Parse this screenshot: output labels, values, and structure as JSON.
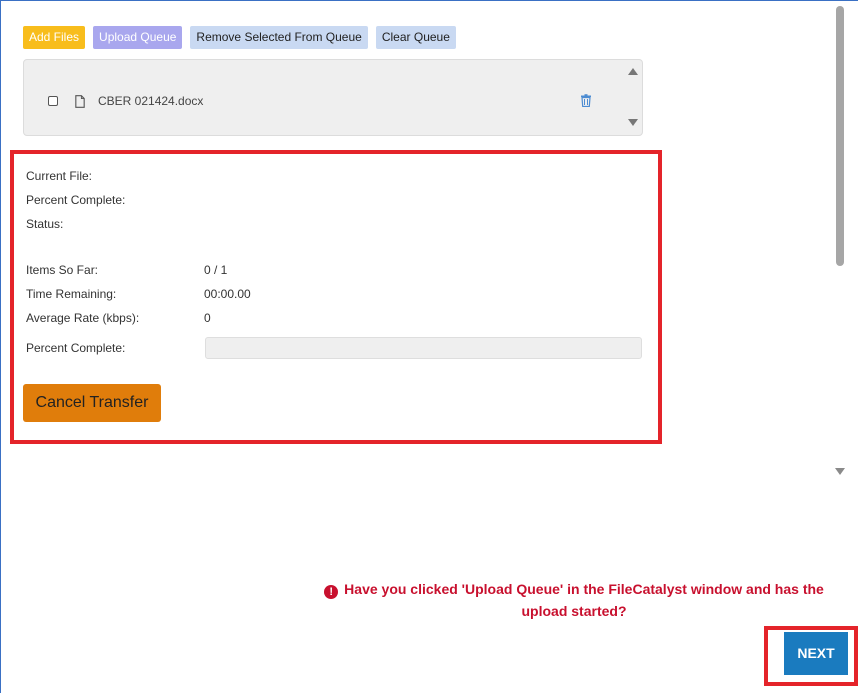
{
  "toolbar": {
    "add_files": "Add Files",
    "upload_queue": "Upload Queue",
    "remove_selected": "Remove Selected From Queue",
    "clear_queue": "Clear Queue"
  },
  "queue": {
    "files": [
      {
        "name": "CBER 021424.docx",
        "checked": false
      }
    ]
  },
  "status": {
    "current_file_label": "Current File:",
    "current_file_value": "",
    "percent_complete_label": "Percent Complete:",
    "percent_complete_value": "",
    "status_label": "Status:",
    "status_value": "",
    "items_so_far_label": "Items So Far:",
    "items_so_far_value": "0 / 1",
    "time_remaining_label": "Time Remaining:",
    "time_remaining_value": "00:00.00",
    "average_rate_label": "Average Rate (kbps):",
    "average_rate_value": "0",
    "progress_label": "Percent Complete:",
    "progress_fraction": 0,
    "cancel_label": "Cancel Transfer"
  },
  "prompt": {
    "icon": "exclamation-circle-icon",
    "text": "Have you clicked 'Upload Queue' in the FileCatalyst window and has the upload started?"
  },
  "next_label": "NEXT",
  "colors": {
    "add_files": "#f8bd1c",
    "upload_queue": "#a9a7ee",
    "secondary_buttons": "#c9d9f2",
    "cancel_button": "#e07d0b",
    "next_button": "#1a7bbf",
    "highlight": "#e4242a",
    "warning_text": "#c8102e"
  }
}
